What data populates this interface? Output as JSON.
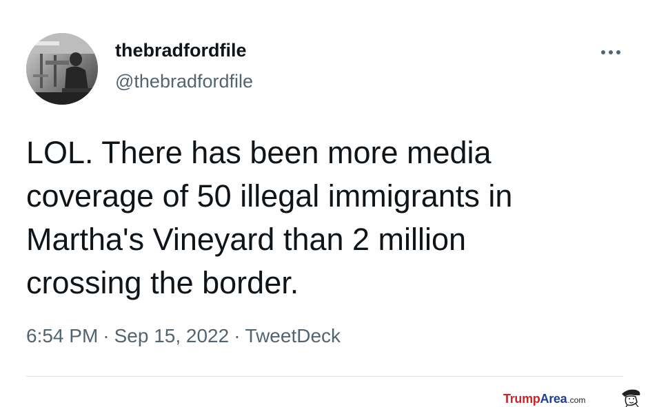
{
  "tweet": {
    "display_name": "thebradfordfile",
    "handle": "@thebradfordfile",
    "text_lines": [
      "LOL. There has been more media",
      "coverage of 50 illegal immigrants in",
      "Martha's Vineyard than 2 million",
      "crossing the border."
    ],
    "time": "6:54 PM",
    "date": "Sep 15, 2022",
    "source": "TweetDeck",
    "separator": "·"
  },
  "icons": {
    "more": "more-horizontal-icon",
    "avatar": "profile-photo"
  },
  "watermark": {
    "brand_part1": "Trump",
    "brand_part2": "Area",
    "brand_suffix": ".com"
  },
  "colors": {
    "text_primary": "#0f1419",
    "text_secondary": "#536471",
    "divider": "#dfe3e6",
    "watermark_red": "#c0282d",
    "watermark_blue": "#1e3f8f"
  }
}
